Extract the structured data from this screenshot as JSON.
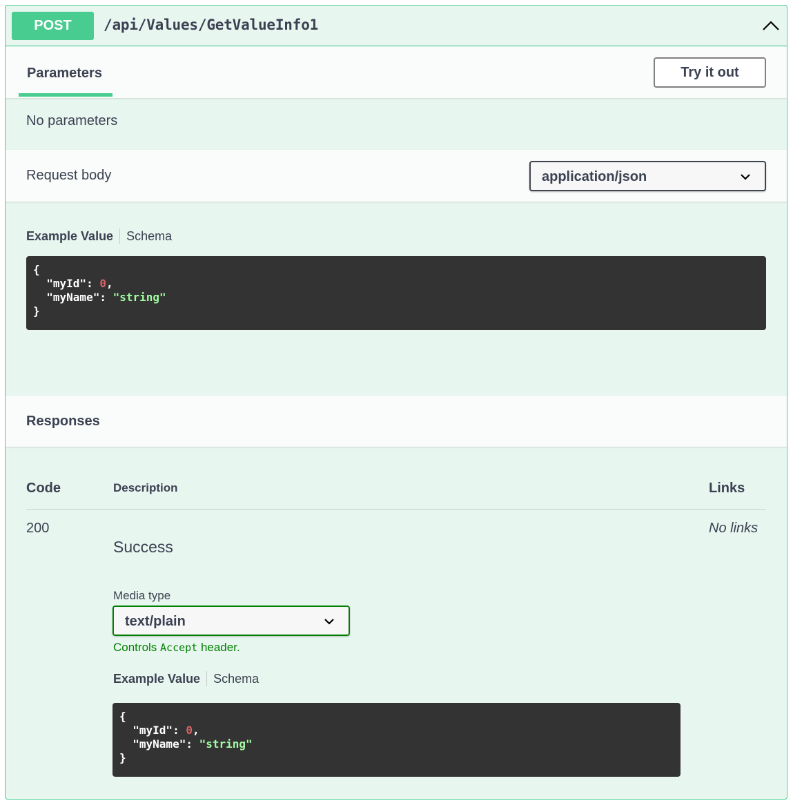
{
  "operation": {
    "method": "POST",
    "path": "/api/Values/GetValueInfo1"
  },
  "parameters": {
    "tab_label": "Parameters",
    "try_button": "Try it out",
    "empty_text": "No parameters"
  },
  "request_body": {
    "label": "Request body",
    "content_type": "application/json",
    "example_tab": "Example Value",
    "schema_tab": "Schema",
    "example": {
      "open": "{",
      "field1_key": "\"myId\"",
      "field1_value": "0",
      "field2_key": "\"myName\"",
      "field2_value": "\"string\"",
      "close": "}"
    }
  },
  "responses": {
    "title": "Responses",
    "columns": {
      "code": "Code",
      "description": "Description",
      "links": "Links"
    },
    "rows": [
      {
        "code": "200",
        "description": "Success",
        "links": "No links",
        "media_type_label": "Media type",
        "media_type": "text/plain",
        "controls_prefix": "Controls ",
        "controls_code": "Accept",
        "controls_suffix": " header.",
        "example_tab": "Example Value",
        "schema_tab": "Schema",
        "example": {
          "open": "{",
          "field1_key": "\"myId\"",
          "field1_value": "0",
          "field2_key": "\"myName\"",
          "field2_value": "\"string\"",
          "close": "}"
        }
      }
    ]
  },
  "colors": {
    "post_accent": "#49cc90",
    "block_background": "#e8f6f0",
    "code_background": "#333333",
    "code_number": "#d36363",
    "code_string": "#a2fca2",
    "controls_text": "#008000"
  },
  "icons": {
    "collapse": "chevron-up-icon",
    "select_arrow": "chevron-down-icon"
  }
}
